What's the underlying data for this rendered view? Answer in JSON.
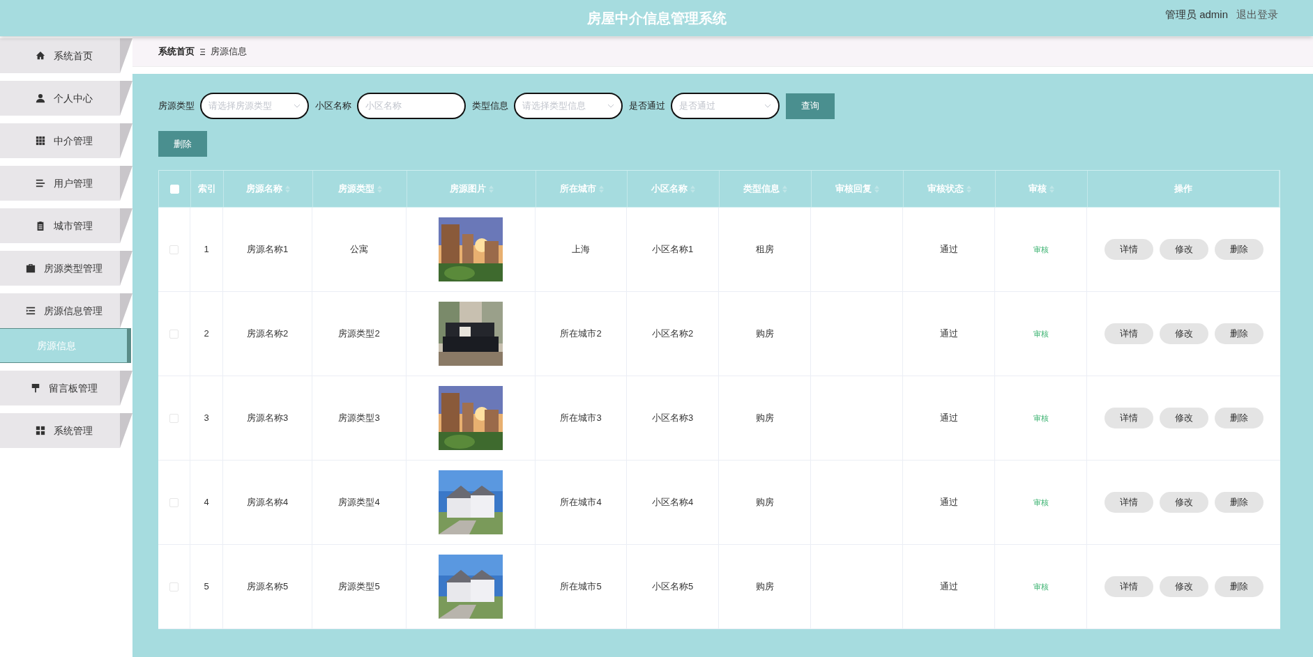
{
  "header": {
    "title": "房屋中介信息管理系统",
    "user": "管理员 admin",
    "logout": "退出登录"
  },
  "sidebar": {
    "items": [
      {
        "label": "系统首页",
        "selected": false
      },
      {
        "label": "个人中心",
        "selected": false
      },
      {
        "label": "中介管理",
        "selected": false
      },
      {
        "label": "用户管理",
        "selected": false
      },
      {
        "label": "城市管理",
        "selected": false
      },
      {
        "label": "房源类型管理",
        "selected": false
      },
      {
        "label": "房源信息管理",
        "selected": false,
        "children": [
          {
            "label": "房源信息",
            "selected": true
          }
        ]
      },
      {
        "label": "留言板管理",
        "selected": false
      },
      {
        "label": "系统管理",
        "selected": false
      }
    ]
  },
  "breadcrumb": [
    "系统首页",
    "房源信息"
  ],
  "search": {
    "fields": [
      {
        "label": "房源类型",
        "placeholder": "请选择房源类型",
        "kind": "select"
      },
      {
        "label": "小区名称",
        "placeholder": "小区名称",
        "kind": "text"
      },
      {
        "label": "类型信息",
        "placeholder": "请选择类型信息",
        "kind": "select"
      },
      {
        "label": "是否通过",
        "placeholder": "是否通过",
        "kind": "select"
      }
    ],
    "query_button": "查询"
  },
  "delete_button": "删除",
  "table": {
    "header_checked": false,
    "columns": [
      {
        "label": "索引",
        "sortable": false
      },
      {
        "label": "房源名称",
        "sortable": true
      },
      {
        "label": "房源类型",
        "sortable": true
      },
      {
        "label": "房源图片",
        "sortable": true
      },
      {
        "label": "所在城市",
        "sortable": true
      },
      {
        "label": "小区名称",
        "sortable": true
      },
      {
        "label": "类型信息",
        "sortable": true
      },
      {
        "label": "审核回复",
        "sortable": true
      },
      {
        "label": "审核状态",
        "sortable": true
      },
      {
        "label": "审核",
        "sortable": true
      },
      {
        "label": "操作",
        "sortable": false
      }
    ],
    "rows": [
      {
        "checked": false,
        "index": "1",
        "name": "房源名称1",
        "type": "公寓",
        "city": "上海",
        "community": "小区名称1",
        "info": "租房",
        "status": "通过",
        "audit": "审核",
        "actions": [
          "详情",
          "修改",
          "删除"
        ]
      },
      {
        "checked": false,
        "index": "2",
        "name": "房源名称2",
        "type": "房源类型2",
        "city": "所在城市2",
        "community": "小区名称2",
        "info": "购房",
        "status": "通过",
        "audit": "审核",
        "actions": [
          "详情",
          "修改",
          "删除"
        ]
      },
      {
        "checked": false,
        "index": "3",
        "name": "房源名称3",
        "type": "房源类型3",
        "city": "所在城市3",
        "community": "小区名称3",
        "info": "购房",
        "status": "通过",
        "audit": "审核",
        "actions": [
          "详情",
          "修改",
          "删除"
        ]
      },
      {
        "checked": false,
        "index": "4",
        "name": "房源名称4",
        "type": "房源类型4",
        "city": "所在城市4",
        "community": "小区名称4",
        "info": "购房",
        "status": "通过",
        "audit": "审核",
        "actions": [
          "详情",
          "修改",
          "删除"
        ]
      },
      {
        "checked": false,
        "index": "5",
        "name": "房源名称5",
        "type": "房源类型5",
        "city": "所在城市5",
        "community": "小区名称5",
        "info": "购房",
        "status": "通过",
        "audit": "审核",
        "actions": [
          "详情",
          "修改",
          "删除"
        ]
      }
    ]
  }
}
